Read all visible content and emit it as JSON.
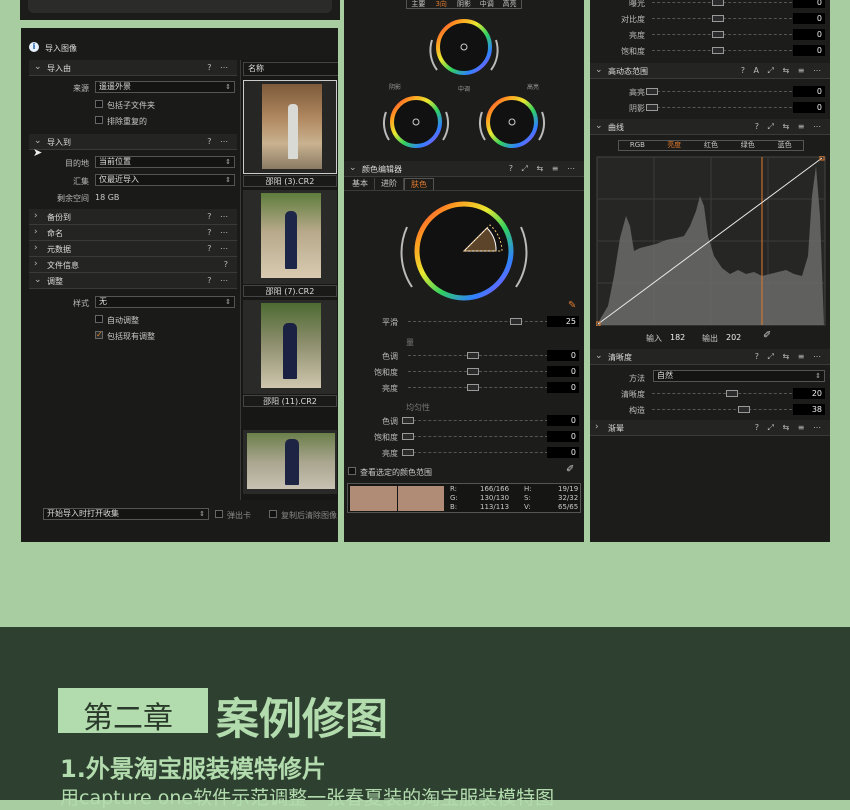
{
  "import_panel": {
    "title": "导入图像",
    "sections": {
      "import_from": "导入由",
      "import_to": "导入到",
      "backup": "备份到",
      "naming": "命名",
      "metadata": "元数据",
      "file_info": "文件信息",
      "adjust": "调整"
    },
    "source_label": "来源",
    "source_value": "遥遥外景",
    "include_subfolders": "包括子文件夹",
    "exclude_duplicates": "排除重复的",
    "destination_label": "目的地",
    "destination_value": "当前位置",
    "collection_label": "汇集",
    "collection_value": "仅最近导入",
    "space_label": "剩余空间",
    "space_value": "18 GB",
    "style_label": "样式",
    "style_value": "无",
    "auto_adjust": "自动调整",
    "include_existing": "包括现有调整",
    "bottom_select": "开始导入时打开收集",
    "eject": "弹出卡",
    "copy_delete": "复制后清除图像",
    "name_header": "名称",
    "thumbnails": [
      "邵阳 (3).CR2",
      "邵阳 (7).CR2",
      "邵阳 (11).CR2"
    ]
  },
  "color_panel": {
    "tabs_top": [
      "主要",
      "3向",
      "阴影",
      "中调",
      "高亮"
    ],
    "wheel_labels": [
      "阴影",
      "中调",
      "高亮"
    ],
    "editor_title": "颜色编辑器",
    "editor_tabs": [
      "基本",
      "进阶",
      "肤色"
    ],
    "smooth_label": "平滑",
    "smooth_value": "25",
    "amount_heading": "量",
    "uniformity_heading": "均匀性",
    "hue_label": "色调",
    "saturation_label": "饱和度",
    "lightness_label": "亮度",
    "amount_values": [
      "0",
      "0",
      "0"
    ],
    "uniformity_values": [
      "0",
      "0",
      "0"
    ],
    "view_selected": "查看选定的颜色范围",
    "readout": {
      "r": "R:",
      "r_val": "166/166",
      "g": "G:",
      "g_val": "130/130",
      "b": "B:",
      "b_val": "113/113",
      "h": "H:",
      "h_val": "19/19",
      "s": "S:",
      "s_val": "32/32",
      "v": "V:",
      "v_val": "65/65"
    },
    "swatch_color": "#b08b76"
  },
  "right_panel": {
    "exposure_rows": [
      {
        "label": "曝光",
        "value": "0"
      },
      {
        "label": "对比度",
        "value": "0"
      },
      {
        "label": "亮度",
        "value": "0"
      },
      {
        "label": "饱和度",
        "value": "0"
      }
    ],
    "hdr_title": "高动态范围",
    "hdr_rows": [
      {
        "label": "高亮",
        "value": "0"
      },
      {
        "label": "阴影",
        "value": "0"
      }
    ],
    "curve_title": "曲线",
    "curve_tabs": [
      "RGB",
      "亮度",
      "红色",
      "绿色",
      "蓝色"
    ],
    "curve_input_label": "输入",
    "curve_input_value": "182",
    "curve_output_label": "输出",
    "curve_output_value": "202",
    "clarity_title": "清晰度",
    "method_label": "方法",
    "method_value": "自然",
    "clarity_label": "清晰度",
    "clarity_value": "20",
    "structure_label": "构造",
    "structure_value": "38",
    "vignette_title": "渐晕"
  },
  "footer": {
    "chapter": "第二章",
    "heading": "案例修图",
    "subtitle": "1.外景淘宝服装模特修片",
    "description": "用capture one软件示范调整一张春夏装的淘宝服装模特图"
  },
  "colors": {
    "accent": "#e07a2e",
    "page_bg": "#a7cda0",
    "footer_bg": "#2e4130",
    "panel_bg": "#1c1c1a"
  }
}
